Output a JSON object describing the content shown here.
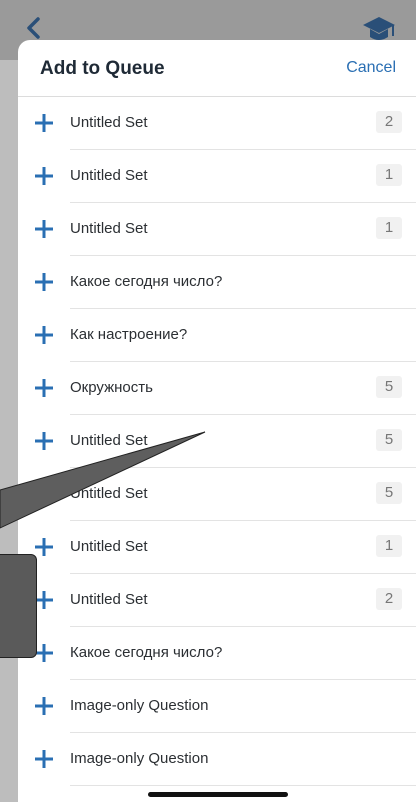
{
  "colors": {
    "accent": "#2a6fb3",
    "title": "#1f2a36"
  },
  "background": {
    "back_icon": "chevron-left-icon",
    "cap_icon": "graduation-cap-icon"
  },
  "sheet": {
    "title": "Add to Queue",
    "cancel_label": "Cancel",
    "add_icon": "plus-icon"
  },
  "rows": [
    {
      "label": "Untitled Set",
      "count": "2"
    },
    {
      "label": "Untitled Set",
      "count": "1"
    },
    {
      "label": "Untitled Set",
      "count": "1"
    },
    {
      "label": "Какое сегодня число?",
      "count": ""
    },
    {
      "label": "Как настроение?",
      "count": ""
    },
    {
      "label": "Окружность",
      "count": "5"
    },
    {
      "label": "Untitled Set",
      "count": "5"
    },
    {
      "label": "Untitled Set",
      "count": "5"
    },
    {
      "label": "Untitled Set",
      "count": "1"
    },
    {
      "label": "Untitled Set",
      "count": "2"
    },
    {
      "label": "Какое сегодня число?",
      "count": ""
    },
    {
      "label": "Image-only Question",
      "count": ""
    },
    {
      "label": "Image-only Question",
      "count": ""
    }
  ]
}
